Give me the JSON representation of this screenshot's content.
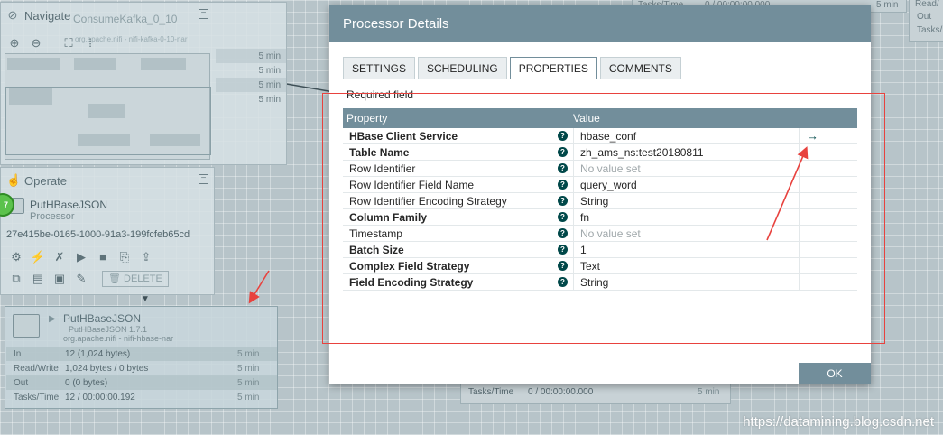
{
  "navigate": {
    "title": "Navigate",
    "bg_text_1": "ConsumeKafka_0_10",
    "bg_text_2": "org.apache.nifi - nifi-kafka-0-10-nar",
    "time_rows": [
      "5 min",
      "5 min",
      "5 min",
      "5 min"
    ]
  },
  "operate": {
    "title": "Operate",
    "component_name": "PutHBaseJSON",
    "component_type": "Processor",
    "component_id": "27e415be-0165-1000-91a3-199fcfeb65cd",
    "delete_label": "DELETE",
    "badge": "7"
  },
  "processor_card": {
    "name": "PutHBaseJSON",
    "type": "PutHBaseJSON 1.7.1",
    "bundle": "org.apache.nifi - nifi-hbase-nar",
    "stats": [
      {
        "label": "In",
        "value": "12 (1,024 bytes)",
        "time": "5 min"
      },
      {
        "label": "Read/Write",
        "value": "1,024 bytes / 0 bytes",
        "time": "5 min"
      },
      {
        "label": "Out",
        "value": "0 (0 bytes)",
        "time": "5 min"
      },
      {
        "label": "Tasks/Time",
        "value": "12 / 00:00:00.192",
        "time": "5 min"
      }
    ]
  },
  "background_misc": {
    "top_tasks": "Tasks/Time",
    "top_tasks_value": "0 / 00:00:00.000",
    "top_time": "5 min",
    "right_readwrite": "Read/",
    "right_out": "Out",
    "right_tasks": "Tasks/",
    "bottom_tasks": "Tasks/Time",
    "bottom_tasks_value": "0 / 00:00:00.000",
    "bottom_time": "5 min"
  },
  "dialog": {
    "title": "Processor Details",
    "tabs": [
      "SETTINGS",
      "SCHEDULING",
      "PROPERTIES",
      "COMMENTS"
    ],
    "active_tab": "PROPERTIES",
    "required_note": "Required field",
    "columns": {
      "property": "Property",
      "value": "Value"
    },
    "ok_label": "OK",
    "properties": [
      {
        "name": "HBase Client Service",
        "value": "hbase_conf",
        "required": true,
        "empty": false,
        "action": "→"
      },
      {
        "name": "Table Name",
        "value": "zh_ams_ns:test20180811",
        "required": true,
        "empty": false,
        "action": ""
      },
      {
        "name": "Row Identifier",
        "value": "No value set",
        "required": false,
        "empty": true,
        "action": ""
      },
      {
        "name": "Row Identifier Field Name",
        "value": "query_word",
        "required": false,
        "empty": false,
        "action": ""
      },
      {
        "name": "Row Identifier Encoding Strategy",
        "value": "String",
        "required": false,
        "empty": false,
        "action": ""
      },
      {
        "name": "Column Family",
        "value": "fn",
        "required": true,
        "empty": false,
        "action": ""
      },
      {
        "name": "Timestamp",
        "value": "No value set",
        "required": false,
        "empty": true,
        "action": ""
      },
      {
        "name": "Batch Size",
        "value": "1",
        "required": true,
        "empty": false,
        "action": ""
      },
      {
        "name": "Complex Field Strategy",
        "value": "Text",
        "required": true,
        "empty": false,
        "action": ""
      },
      {
        "name": "Field Encoding Strategy",
        "value": "String",
        "required": true,
        "empty": false,
        "action": ""
      }
    ]
  },
  "watermark": "https://datamining.blog.csdn.net",
  "colors": {
    "header": "#728e9b",
    "annotation": "#e8423e",
    "help_icon": "#004849"
  }
}
